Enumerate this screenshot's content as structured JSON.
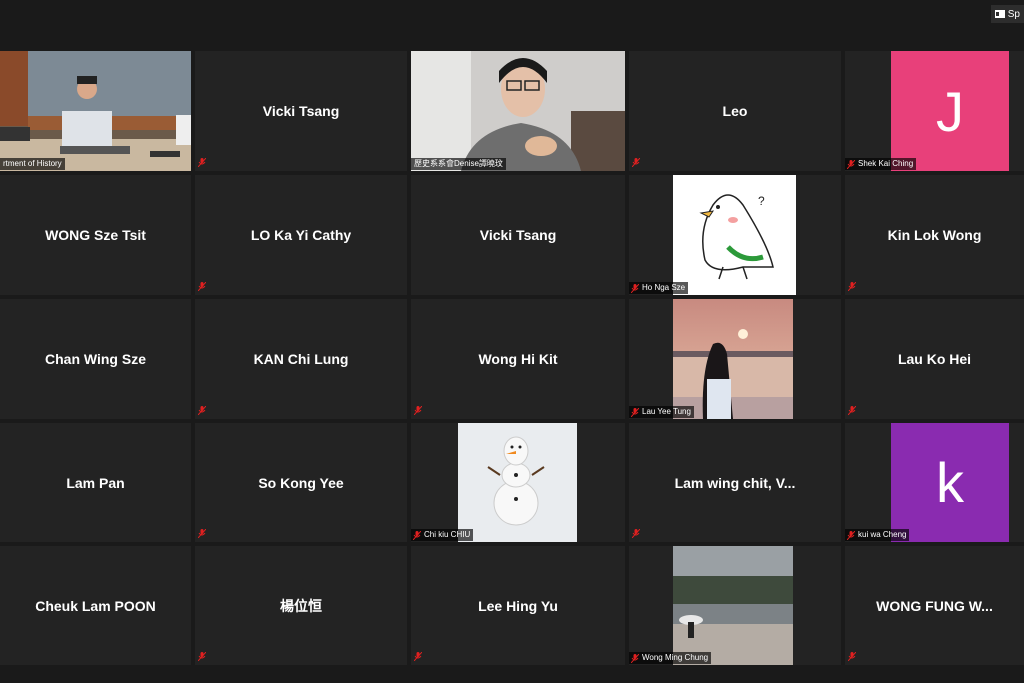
{
  "topbar": {
    "speaker_label": "Sp"
  },
  "tiles": [
    {
      "name": "",
      "label": "rtment of History"
    },
    {
      "name": "Vicki Tsang"
    },
    {
      "name": "",
      "label": "歷史系系會Denise譚曉玟"
    },
    {
      "name": "Leo"
    },
    {
      "name": "",
      "label": "Shek Kai Ching",
      "avatar": "J",
      "avatar_color": "#e8407a"
    },
    {
      "name": "WONG Sze Tsit"
    },
    {
      "name": "LO Ka Yi Cathy"
    },
    {
      "name": "Vicki Tsang"
    },
    {
      "name": "",
      "label": "Ho Nga Sze"
    },
    {
      "name": "Kin Lok Wong"
    },
    {
      "name": "Chan Wing Sze"
    },
    {
      "name": "KAN Chi Lung"
    },
    {
      "name": "Wong Hi Kit"
    },
    {
      "name": "",
      "label": "Lau Yee Tung"
    },
    {
      "name": "Lau Ko Hei"
    },
    {
      "name": "Lam Pan"
    },
    {
      "name": "So Kong Yee"
    },
    {
      "name": "",
      "label": "Chi kiu CHIU"
    },
    {
      "name": "Lam wing chit, V..."
    },
    {
      "name": "",
      "label": "kui wa Cheng",
      "avatar": "k",
      "avatar_color": "#8a2bb0"
    },
    {
      "name": "Cheuk Lam POON"
    },
    {
      "name": "楊位恒"
    },
    {
      "name": "Lee Hing Yu"
    },
    {
      "name": "",
      "label": "Wong Ming Chung"
    },
    {
      "name": "WONG FUNG W..."
    }
  ],
  "colors": {
    "active_border": "#a7e03a",
    "mute_red": "#e02020",
    "tile_bg": "#232323"
  },
  "icons": {
    "mute": "microphone-muted-icon",
    "speaker": "speaker-view-icon"
  }
}
